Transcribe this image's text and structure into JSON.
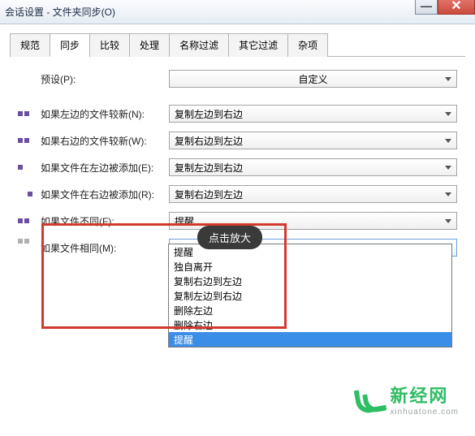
{
  "window": {
    "title": "会话设置 - 文件夹同步(O)"
  },
  "tabs": [
    "规范",
    "同步",
    "比较",
    "处理",
    "名称过滤",
    "其它过滤",
    "杂项"
  ],
  "activeTab": 1,
  "rows": {
    "preset": {
      "label": "预设(P):",
      "value": "自定义"
    },
    "leftNew": {
      "label": "如果左边的文件较新(N):",
      "value": "复制左边到右边"
    },
    "rightNew": {
      "label": "如果右边的文件较新(W):",
      "value": "复制右边到左边"
    },
    "addLeft": {
      "label": "如果文件在左边被添加(E):",
      "value": "复制左边到右边"
    },
    "addRight": {
      "label": "如果文件在右边被添加(R):",
      "value": "复制右边到左边"
    },
    "diff": {
      "label": "如果文件不同(F):",
      "value": "提醒"
    },
    "same": {
      "label": "如果文件相同(M):",
      "value": "提醒"
    }
  },
  "dropdown": {
    "options": [
      "提醒",
      "独自离开",
      "复制右边到左边",
      "复制左边到右边",
      "删除左边",
      "删除右边",
      "提醒"
    ],
    "cutoff_first": "独自离开",
    "selectedIndex": 6
  },
  "tooltip": "点击放大",
  "logo": {
    "cn": "新经网",
    "en": "xinhuatone.com"
  }
}
